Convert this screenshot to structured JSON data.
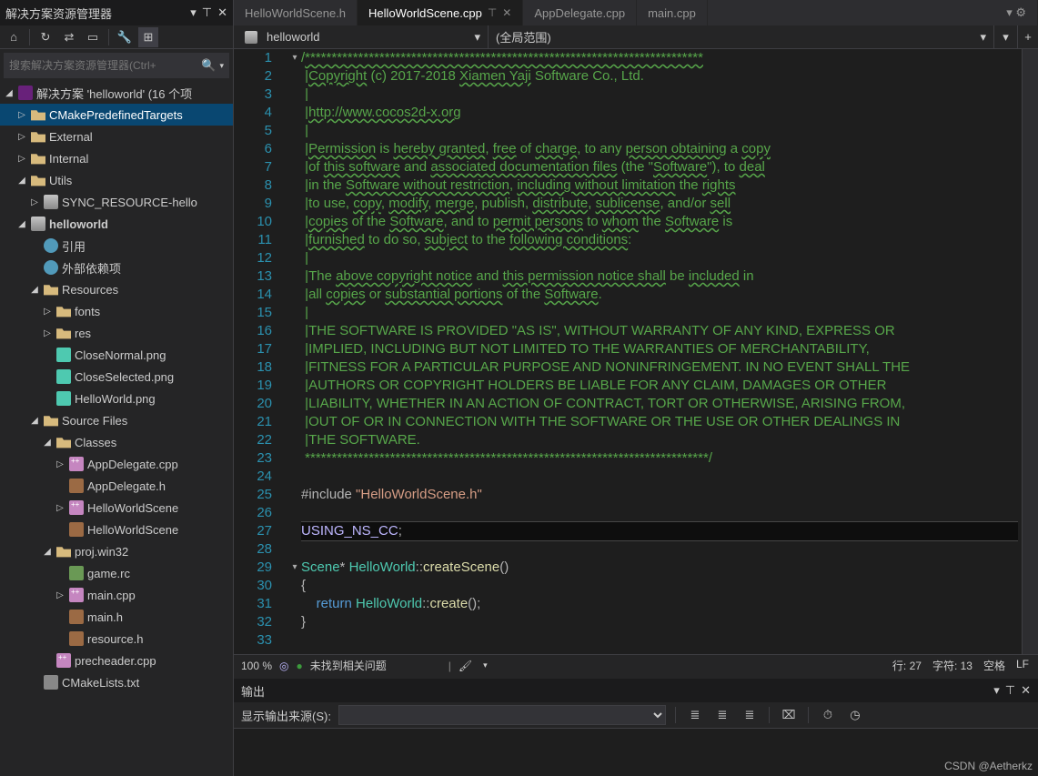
{
  "solution_explorer": {
    "title": "解决方案资源管理器",
    "search_placeholder": "搜索解决方案资源管理器(Ctrl+",
    "root": "解决方案 'helloworld' (16 个项",
    "tree": [
      {
        "d": 1,
        "tw": "▷",
        "ico": "folder",
        "t": "CMakePredefinedTargets",
        "sel": true
      },
      {
        "d": 1,
        "tw": "▷",
        "ico": "folder",
        "t": "External"
      },
      {
        "d": 1,
        "tw": "▷",
        "ico": "folder",
        "t": "Internal"
      },
      {
        "d": 1,
        "tw": "◢",
        "ico": "folder",
        "t": "Utils"
      },
      {
        "d": 2,
        "tw": "▷",
        "ico": "proj",
        "t": "SYNC_RESOURCE-hello"
      },
      {
        "d": 1,
        "tw": "◢",
        "ico": "proj",
        "t": "helloworld",
        "bold": true
      },
      {
        "d": 2,
        "tw": "",
        "ico": "ref",
        "t": "引用"
      },
      {
        "d": 2,
        "tw": "",
        "ico": "ref",
        "t": "外部依赖项"
      },
      {
        "d": 2,
        "tw": "◢",
        "ico": "folder",
        "t": "Resources"
      },
      {
        "d": 3,
        "tw": "▷",
        "ico": "folder",
        "t": "fonts"
      },
      {
        "d": 3,
        "tw": "▷",
        "ico": "folder",
        "t": "res"
      },
      {
        "d": 3,
        "tw": "",
        "ico": "png",
        "t": "CloseNormal.png"
      },
      {
        "d": 3,
        "tw": "",
        "ico": "png",
        "t": "CloseSelected.png"
      },
      {
        "d": 3,
        "tw": "",
        "ico": "png",
        "t": "HelloWorld.png"
      },
      {
        "d": 2,
        "tw": "◢",
        "ico": "folder",
        "t": "Source Files"
      },
      {
        "d": 3,
        "tw": "◢",
        "ico": "folder",
        "t": "Classes"
      },
      {
        "d": 4,
        "tw": "▷",
        "ico": "cpp",
        "t": "AppDelegate.cpp"
      },
      {
        "d": 4,
        "tw": "",
        "ico": "h",
        "t": "AppDelegate.h"
      },
      {
        "d": 4,
        "tw": "▷",
        "ico": "cpp",
        "t": "HelloWorldScene"
      },
      {
        "d": 4,
        "tw": "",
        "ico": "h",
        "t": "HelloWorldScene"
      },
      {
        "d": 3,
        "tw": "◢",
        "ico": "folder",
        "t": "proj.win32"
      },
      {
        "d": 4,
        "tw": "",
        "ico": "rc",
        "t": "game.rc"
      },
      {
        "d": 4,
        "tw": "▷",
        "ico": "cpp",
        "t": "main.cpp"
      },
      {
        "d": 4,
        "tw": "",
        "ico": "h",
        "t": "main.h"
      },
      {
        "d": 4,
        "tw": "",
        "ico": "h",
        "t": "resource.h"
      },
      {
        "d": 3,
        "tw": "",
        "ico": "cpp",
        "t": "precheader.cpp"
      },
      {
        "d": 2,
        "tw": "",
        "ico": "txt",
        "t": "CMakeLists.txt"
      }
    ]
  },
  "tabs": [
    {
      "label": "HelloWorldScene.h",
      "active": false
    },
    {
      "label": "HelloWorldScene.cpp",
      "active": true
    },
    {
      "label": "AppDelegate.cpp",
      "active": false
    },
    {
      "label": "main.cpp",
      "active": false
    }
  ],
  "navbar": {
    "scope": "helloworld",
    "context": "(全局范围)"
  },
  "code": {
    "lines": [
      {
        "n": 1,
        "fold": "▾",
        "h": "<span class='c-cm'>/</span><span class='c-cm-u'>***************************************************************************</span>"
      },
      {
        "n": 2,
        "h": " <span class='c-cm'>|</span><span class='c-cm-u'>Copyright</span><span class='c-cm'> (c) 2017-2018 </span><span class='c-cm-u'>Xiamen Yaji</span><span class='c-cm'> Software Co., Ltd.</span>"
      },
      {
        "n": 3,
        "h": " <span class='c-cm'>|</span>"
      },
      {
        "n": 4,
        "h": " <span class='c-cm'>|</span><span class='c-cm-u'>http://www.cocos2d-x.org</span>"
      },
      {
        "n": 5,
        "h": " <span class='c-cm'>|</span>"
      },
      {
        "n": 6,
        "h": " <span class='c-cm'>|</span><span class='c-cm-u'>Permission</span><span class='c-cm'> is </span><span class='c-cm-u'>hereby granted</span><span class='c-cm'>, </span><span class='c-cm-u'>free</span><span class='c-cm'> of </span><span class='c-cm-u'>charge</span><span class='c-cm'>, to any </span><span class='c-cm-u'>person obtaining</span><span class='c-cm'> a </span><span class='c-cm-u'>copy</span>"
      },
      {
        "n": 7,
        "h": " <span class='c-cm'>|of </span><span class='c-cm-u'>this software</span><span class='c-cm'> and </span><span class='c-cm-u'>associated documentation files</span><span class='c-cm'> (the \"</span><span class='c-cm-u'>Software</span><span class='c-cm'>\"), to </span><span class='c-cm-u'>deal</span>"
      },
      {
        "n": 8,
        "h": " <span class='c-cm'>|in the </span><span class='c-cm-u'>Software without restriction</span><span class='c-cm'>, </span><span class='c-cm-u'>including without limitation</span><span class='c-cm'> the </span><span class='c-cm-u'>rights</span>"
      },
      {
        "n": 9,
        "h": " <span class='c-cm'>|to use, </span><span class='c-cm-u'>copy</span><span class='c-cm'>, </span><span class='c-cm-u'>modify</span><span class='c-cm'>, </span><span class='c-cm-u'>merge</span><span class='c-cm'>, publish, </span><span class='c-cm-u'>distribute</span><span class='c-cm'>, </span><span class='c-cm-u'>sublicense</span><span class='c-cm'>, and/or </span><span class='c-cm-u'>sell</span>"
      },
      {
        "n": 10,
        "h": " <span class='c-cm'>|</span><span class='c-cm-u'>copies</span><span class='c-cm'> of the </span><span class='c-cm-u'>Software</span><span class='c-cm'>, and to </span><span class='c-cm-u'>permit persons</span><span class='c-cm'> to </span><span class='c-cm-u'>whom</span><span class='c-cm'> the </span><span class='c-cm-u'>Software</span><span class='c-cm'> is</span>"
      },
      {
        "n": 11,
        "h": " <span class='c-cm'>|</span><span class='c-cm-u'>furnished</span><span class='c-cm'> to do so, </span><span class='c-cm-u'>subject</span><span class='c-cm'> to the </span><span class='c-cm-u'>following conditions</span><span class='c-cm'>:</span>"
      },
      {
        "n": 12,
        "h": " <span class='c-cm'>|</span>"
      },
      {
        "n": 13,
        "h": " <span class='c-cm'>|The </span><span class='c-cm-u'>above copyright notice</span><span class='c-cm'> and </span><span class='c-cm-u'>this permission notice shall</span><span class='c-cm'> be </span><span class='c-cm-u'>included</span><span class='c-cm'> in</span>"
      },
      {
        "n": 14,
        "h": " <span class='c-cm'>|all </span><span class='c-cm-u'>copies</span><span class='c-cm'> or </span><span class='c-cm-u'>substantial portions</span><span class='c-cm'> of the </span><span class='c-cm-u'>Software</span><span class='c-cm'>.</span>"
      },
      {
        "n": 15,
        "h": " <span class='c-cm'>|</span>"
      },
      {
        "n": 16,
        "h": " <span class='c-cm'>|THE SOFTWARE IS PROVIDED \"AS IS\", WITHOUT WARRANTY OF ANY KIND, EXPRESS OR</span>"
      },
      {
        "n": 17,
        "h": " <span class='c-cm'>|IMPLIED, INCLUDING BUT NOT LIMITED TO THE WARRANTIES OF MERCHANTABILITY,</span>"
      },
      {
        "n": 18,
        "h": " <span class='c-cm'>|FITNESS FOR A PARTICULAR PURPOSE AND NONINFRINGEMENT. IN NO EVENT SHALL THE</span>"
      },
      {
        "n": 19,
        "h": " <span class='c-cm'>|AUTHORS OR COPYRIGHT HOLDERS BE LIABLE FOR ANY CLAIM, DAMAGES OR OTHER</span>"
      },
      {
        "n": 20,
        "h": " <span class='c-cm'>|LIABILITY, WHETHER IN AN ACTION OF CONTRACT, TORT OR OTHERWISE, ARISING FROM,</span>"
      },
      {
        "n": 21,
        "h": " <span class='c-cm'>|OUT OF OR IN CONNECTION WITH THE SOFTWARE OR THE USE OR OTHER DEALINGS IN</span>"
      },
      {
        "n": 22,
        "h": " <span class='c-cm'>|THE SOFTWARE.</span>"
      },
      {
        "n": 23,
        "h": " <span class='c-cm'>****************************************************************************/</span>"
      },
      {
        "n": 24,
        "h": ""
      },
      {
        "n": 25,
        "h": "<span class='c-op'>#include </span><span class='c-str'>\"HelloWorldScene.h\"</span>"
      },
      {
        "n": 26,
        "h": ""
      },
      {
        "n": 27,
        "cur": true,
        "h": "<span class='c-mac'>USING_NS_CC</span><span class='c-op'>;</span>"
      },
      {
        "n": 28,
        "h": ""
      },
      {
        "n": 29,
        "fold": "▾",
        "h": "<span class='c-type'>Scene</span><span class='c-op'>* </span><span class='c-type'>HelloWorld</span><span class='c-op'>::</span><span class='c-fn'>createScene</span><span class='c-op'>()</span>"
      },
      {
        "n": 30,
        "h": "<span class='c-op'>{</span>"
      },
      {
        "n": 31,
        "h": "    <span class='c-kw'>return</span> <span class='c-type'>HelloWorld</span><span class='c-op'>::</span><span class='c-fn'>create</span><span class='c-op'>();</span>"
      },
      {
        "n": 32,
        "h": "<span class='c-op'>}</span>"
      },
      {
        "n": 33,
        "h": ""
      }
    ]
  },
  "statusbar": {
    "zoom": "100 %",
    "issues": "未找到相关问题",
    "line": "行: 27",
    "col": "字符: 13",
    "indent": "空格",
    "eol": "LF"
  },
  "output": {
    "title": "输出",
    "label": "显示输出来源(S):"
  },
  "watermark": "CSDN @Aetherkz"
}
